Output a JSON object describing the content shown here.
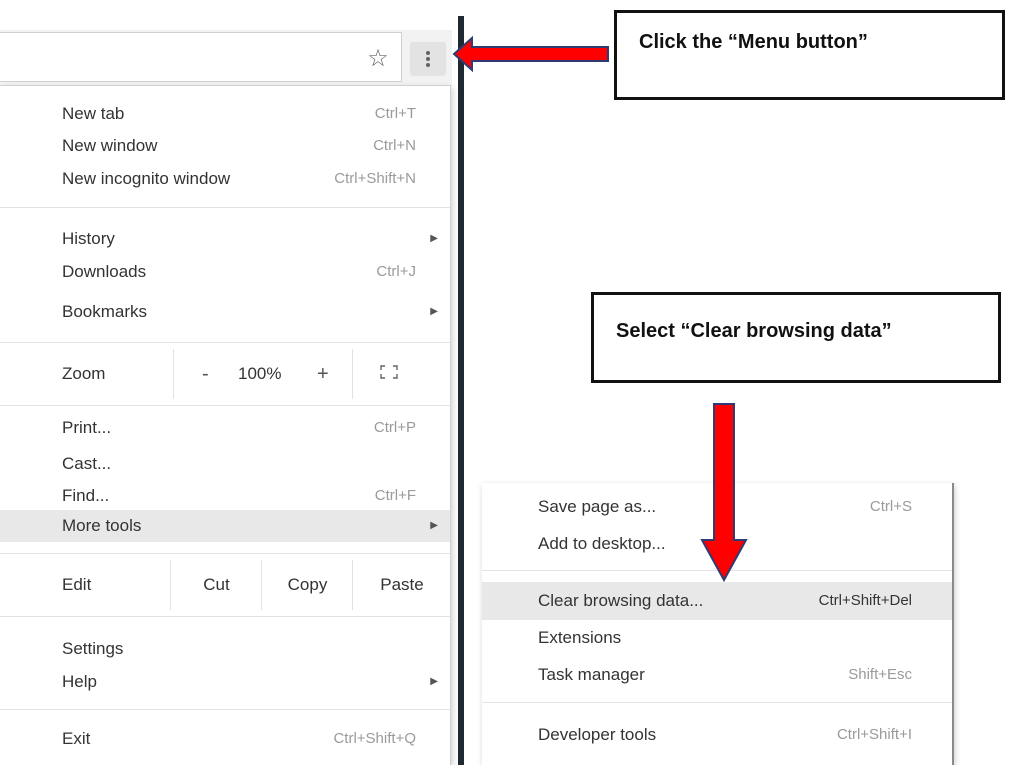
{
  "toolbar": {
    "star_glyph": "☆",
    "menu_icon": "vertical-dots-icon"
  },
  "main_menu": {
    "groups": [
      [
        {
          "label": "New tab",
          "shortcut": "Ctrl+T"
        },
        {
          "label": "New window",
          "shortcut": "Ctrl+N"
        },
        {
          "label": "New incognito window",
          "shortcut": "Ctrl+Shift+N"
        }
      ],
      [
        {
          "label": "History",
          "submenu": true
        },
        {
          "label": "Downloads",
          "shortcut": "Ctrl+J"
        },
        {
          "label": "Bookmarks",
          "submenu": true
        }
      ],
      [
        {
          "label": "Print...",
          "shortcut": "Ctrl+P"
        },
        {
          "label": "Cast..."
        },
        {
          "label": "Find...",
          "shortcut": "Ctrl+F"
        },
        {
          "label": "More tools",
          "submenu": true,
          "highlighted": true
        }
      ],
      [
        {
          "label": "Settings"
        },
        {
          "label": "Help",
          "submenu": true
        }
      ],
      [
        {
          "label": "Exit",
          "shortcut": "Ctrl+Shift+Q"
        }
      ]
    ],
    "zoom": {
      "label": "Zoom",
      "minus": "-",
      "level": "100%",
      "plus": "+"
    },
    "edit": {
      "label": "Edit",
      "cut": "Cut",
      "copy": "Copy",
      "paste": "Paste"
    }
  },
  "more_tools_menu": {
    "items": [
      {
        "label": "Save page as...",
        "shortcut": "Ctrl+S"
      },
      {
        "label": "Add to desktop..."
      },
      {
        "label": "Clear browsing data...",
        "shortcut": "Ctrl+Shift+Del",
        "highlighted": true
      },
      {
        "label": "Extensions"
      },
      {
        "label": "Task manager",
        "shortcut": "Shift+Esc"
      },
      {
        "label": "Developer tools",
        "shortcut": "Ctrl+Shift+I"
      }
    ]
  },
  "annotations": {
    "menu_button": "Click the “Menu button”",
    "clear_data": "Select “Clear browsing data”"
  },
  "colors": {
    "arrow_fill": "#ff0000",
    "arrow_stroke": "#2f3b73",
    "highlight": "#e8e8e8"
  }
}
